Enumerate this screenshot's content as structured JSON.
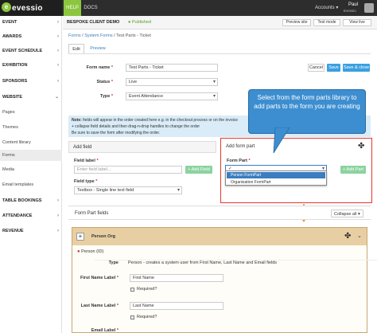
{
  "brand": {
    "name": "evessio",
    "initial": "e",
    "accent": "#8cc63f"
  },
  "topnav": {
    "help": "HELP",
    "docs": "DOCS",
    "accounts": "Accounts ▾",
    "user_name": "Paul",
    "user_sub": "Evessio"
  },
  "sidebar": {
    "items": [
      {
        "label": "EVENT",
        "type": "section"
      },
      {
        "label": "AWARDS",
        "type": "section"
      },
      {
        "label": "EVENT SCHEDULE",
        "type": "section"
      },
      {
        "label": "EXHIBITION",
        "type": "section"
      },
      {
        "label": "SPONSORS",
        "type": "section"
      },
      {
        "label": "WEBSITE",
        "type": "section"
      },
      {
        "label": "Pages",
        "type": "sub"
      },
      {
        "label": "Themes",
        "type": "sub"
      },
      {
        "label": "Content library",
        "type": "sub"
      },
      {
        "label": "Forms",
        "type": "sub",
        "active": true
      },
      {
        "label": "Media",
        "type": "sub"
      },
      {
        "label": "Email templates",
        "type": "sub"
      },
      {
        "label": "TABLE BOOKINGS",
        "type": "section"
      },
      {
        "label": "ATTENDANCE",
        "type": "section"
      },
      {
        "label": "REVENUE",
        "type": "section"
      }
    ]
  },
  "header": {
    "client": "BESPOKE CLIENT DEMO",
    "status": "● Published",
    "buttons": [
      "Preview site",
      "Test mode",
      "View live"
    ]
  },
  "breadcrumb": {
    "forms": "Forms",
    "system_forms": "System Forms",
    "current": "Test Parts - Ticket"
  },
  "tabs": {
    "edit": "Edit",
    "preview": "Preview"
  },
  "form": {
    "name_label": "Form name",
    "name_value": "Test Parts - Ticket",
    "status_label": "Status",
    "status_value": "Live",
    "type_label": "Type",
    "type_value": "Event Attendance",
    "cancel": "Cancel",
    "save": "Save",
    "save_close": "Save & close"
  },
  "notice": {
    "note": "Note:",
    "line1": " fields will appear in the order created here e.g. in the checkout process or on the invoice",
    "line2": "+ collapse field details and then drag-n-drop handles to change the order",
    "line3": "Be sure to save the form after modifying the order."
  },
  "add_field": {
    "title": "Add field",
    "label": "Field label",
    "placeholder": "Enter field label...",
    "type_label": "Field type",
    "type_value": "Textbox - Single line text field",
    "button": "+ Add Field"
  },
  "add_part": {
    "title": "Add form part",
    "label": "Form Part",
    "selected": "✓",
    "options": [
      "Person FormPart",
      "Organisation FormPart"
    ],
    "button": "+ Add Part"
  },
  "callout": {
    "text": "Select from the form parts library to add parts to the form you are creating",
    "color": "#3d8ed0"
  },
  "form_part_fields": {
    "title": "Form Part fields",
    "collapse": "Collapse all ▾",
    "org_name": "Person Org",
    "person_label": "Person",
    "person_tag": "(ID)",
    "type_label": "Type",
    "type_value": "Person - creates a system user from First Name, Last Name and Email fields",
    "first_label": "First Name Label",
    "first_value": "First Name",
    "required": "Required?",
    "last_label": "Last Name Label",
    "last_value": "Last Name",
    "email_label": "Email Label"
  }
}
